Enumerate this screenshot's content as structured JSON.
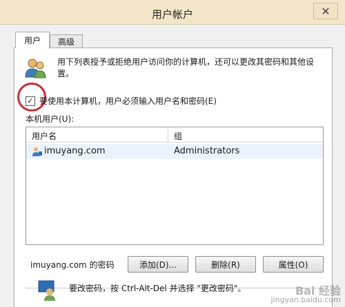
{
  "window": {
    "title": "用户帐户",
    "close_glyph": "✕"
  },
  "tabs": [
    {
      "label": "用户",
      "active": true
    },
    {
      "label": "高级",
      "active": false
    }
  ],
  "description": "用下列表授予或拒绝用户访问你的计算机，还可以更改其密码和其他设置。",
  "require_login": {
    "checked": true,
    "checkmark": "✓",
    "label": "要使用本计算机，用户必须输入用户名和密码(E)"
  },
  "local_users": {
    "label": "本机用户(U):",
    "columns": [
      "用户名",
      "组"
    ],
    "rows": [
      {
        "user": "imuyang.com",
        "group": "Administrators"
      }
    ]
  },
  "buttons": {
    "add": "添加(D)...",
    "remove": "删除(R)",
    "properties": "属性(O)"
  },
  "password_group": {
    "title": "imuyang.com 的密码",
    "text": "要改密码，按 Ctrl-Alt-Del 并选择 \"更改密码\"。"
  },
  "watermark": {
    "logo": "Bai 经验",
    "url": "jingyan.baidu.com"
  },
  "colors": {
    "highlight": "#d9252a",
    "titlebar": "#f3e6c8"
  }
}
